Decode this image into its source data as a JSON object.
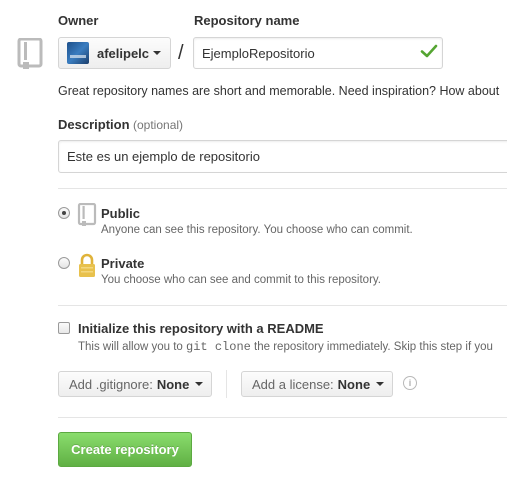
{
  "owner": {
    "label": "Owner",
    "username": "afelipelc",
    "avatar_icon": "user-avatar"
  },
  "repository": {
    "label": "Repository name",
    "separator": "/",
    "value": "EjemploRepositorio",
    "valid_icon": "check-icon",
    "hint": "Great repository names are short and memorable. Need inspiration? How about"
  },
  "description": {
    "label": "Description",
    "optional": "(optional)",
    "value": "Este es un ejemplo de repositorio"
  },
  "visibility": {
    "selected": "public",
    "options": [
      {
        "id": "public",
        "title": "Public",
        "text": "Anyone can see this repository. You choose who can commit.",
        "icon": "repo-icon"
      },
      {
        "id": "private",
        "title": "Private",
        "text": "You choose who can see and commit to this repository.",
        "icon": "lock-icon"
      }
    ]
  },
  "readme": {
    "checked": false,
    "label": "Initialize this repository with a README",
    "text_before": "This will allow you to",
    "command": "git clone",
    "text_after": "the repository immediately. Skip this step if you"
  },
  "gitignore": {
    "prefix": "Add .gitignore:",
    "value": "None"
  },
  "license": {
    "prefix": "Add a license:",
    "value": "None"
  },
  "submit": {
    "label": "Create repository"
  },
  "colors": {
    "primary_button": "#60b044",
    "valid_check": "#55a532",
    "lock_icon": "#e0b33a",
    "icon_gray": "#bbbbbb"
  }
}
